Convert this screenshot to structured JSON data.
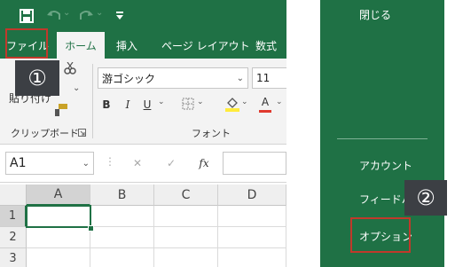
{
  "qat": {
    "save_icon": "save-icon",
    "undo_icon": "undo-icon",
    "redo_icon": "redo-icon",
    "customize_icon": "customize-icon"
  },
  "tabs": {
    "file": "ファイル",
    "home": "ホーム",
    "insert": "挿入",
    "page_layout": "ページ レイアウト",
    "formulas": "数式"
  },
  "callouts": {
    "one": "①",
    "two": "②"
  },
  "clipboard": {
    "paste_label": "貼り付け",
    "group_label": "クリップボード"
  },
  "font": {
    "name": "游ゴシック",
    "size": "11",
    "group_label": "フォント",
    "bold": "B",
    "italic": "I",
    "underline": "U",
    "font_color_letter": "A"
  },
  "formula_bar": {
    "name_box": "A1",
    "cancel": "✕",
    "enter": "✓",
    "fx": "fx"
  },
  "sheet": {
    "columns": [
      "A",
      "B",
      "C",
      "D"
    ],
    "rows": [
      "1",
      "2",
      "3"
    ]
  },
  "backstage": {
    "close": "閉じる",
    "account": "アカウント",
    "feedback": "フィードバッ",
    "options": "オプション"
  },
  "colors": {
    "excel_green": "#1f7145",
    "highlight_red": "#c0392b",
    "badge_dark": "#3c3f44",
    "font_color_red": "#e03a2f",
    "highlight_yellow": "#ffeb3b"
  }
}
